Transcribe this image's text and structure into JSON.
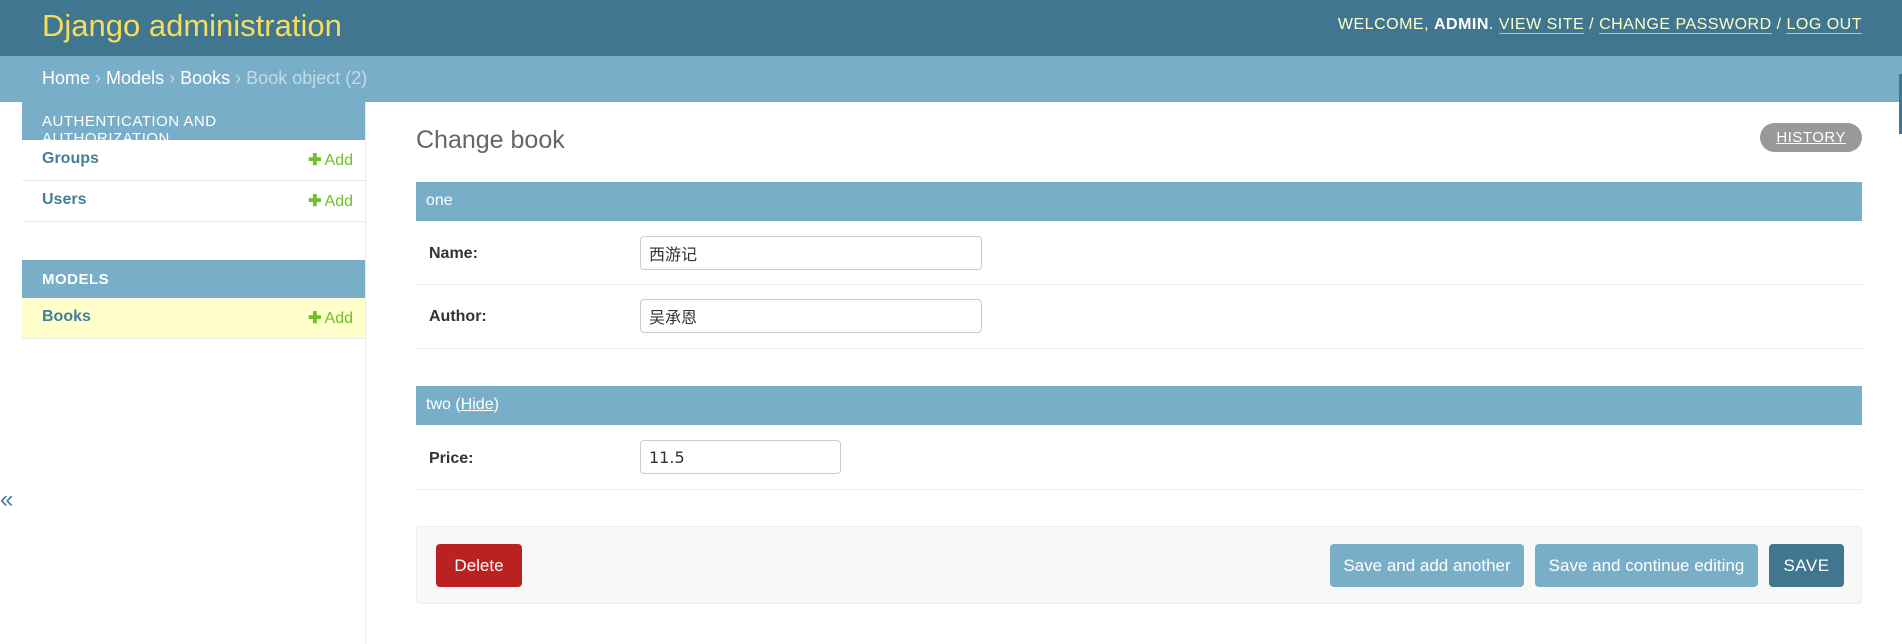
{
  "header": {
    "branding": "Django administration",
    "welcome": "WELCOME,",
    "username": "ADMIN",
    "view_site": "VIEW SITE",
    "change_password": "CHANGE PASSWORD",
    "log_out": "LOG OUT",
    "separator": "/",
    "colors": {
      "background": "#417690",
      "branding": "#f5dd5d"
    }
  },
  "breadcrumbs": {
    "items": [
      "Home",
      "Models",
      "Books"
    ],
    "current": "Book object (2)",
    "separator": "›"
  },
  "sidebar": {
    "toggle_icon": "«",
    "modules": [
      {
        "caption": "AUTHENTICATION AND AUTHORIZATION",
        "models": [
          {
            "name": "Groups",
            "add_label": "Add"
          },
          {
            "name": "Users",
            "add_label": "Add"
          }
        ]
      },
      {
        "caption": "MODELS",
        "models": [
          {
            "name": "Books",
            "add_label": "Add",
            "current": true
          }
        ]
      }
    ]
  },
  "content": {
    "title": "Change book",
    "history_label": "HISTORY",
    "fieldsets": [
      {
        "name": "one",
        "fields": [
          {
            "label": "Name:",
            "value": "西游记"
          },
          {
            "label": "Author:",
            "value": "吴承恩"
          }
        ]
      },
      {
        "name": "two",
        "toggle_open": "(",
        "toggle_label": "Hide",
        "toggle_close": ")",
        "fields": [
          {
            "label": "Price:",
            "value": "11.5"
          }
        ]
      }
    ]
  },
  "submit_row": {
    "delete_label": "Delete",
    "save_add_label": "Save and add another",
    "save_continue_label": "Save and continue editing",
    "save_label": "SAVE",
    "colors": {
      "delete": "#ba2121",
      "secondary": "#79aec8",
      "primary": "#417690"
    }
  }
}
